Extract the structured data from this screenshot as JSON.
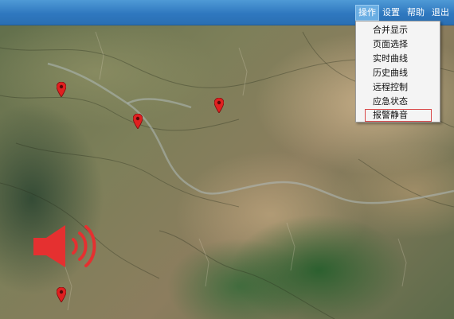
{
  "menubar": {
    "items": [
      {
        "label": "操作",
        "active": true
      },
      {
        "label": "设置",
        "active": false
      },
      {
        "label": "帮助",
        "active": false
      },
      {
        "label": "退出",
        "active": false
      }
    ]
  },
  "dropdown": {
    "items": [
      {
        "label": "合并显示"
      },
      {
        "label": "页面选择"
      },
      {
        "label": "实时曲线"
      },
      {
        "label": "历史曲线"
      },
      {
        "label": "远程控制"
      },
      {
        "label": "应急状态"
      },
      {
        "label": "报警静音",
        "highlighted": true
      }
    ]
  },
  "map": {
    "type": "satellite terrain",
    "markers": [
      {
        "name": "location-pin-1",
        "icon": "map-pin-icon"
      },
      {
        "name": "location-pin-2",
        "icon": "map-pin-icon"
      },
      {
        "name": "location-pin-3",
        "icon": "map-pin-icon"
      },
      {
        "name": "location-pin-4",
        "icon": "map-pin-icon"
      }
    ],
    "alarm_icon": "speaker-alarm-icon"
  },
  "colors": {
    "menubar": "#2f78bf",
    "pin": "#e02020",
    "highlight_border": "#d94a4a",
    "speaker": "#e53030"
  }
}
